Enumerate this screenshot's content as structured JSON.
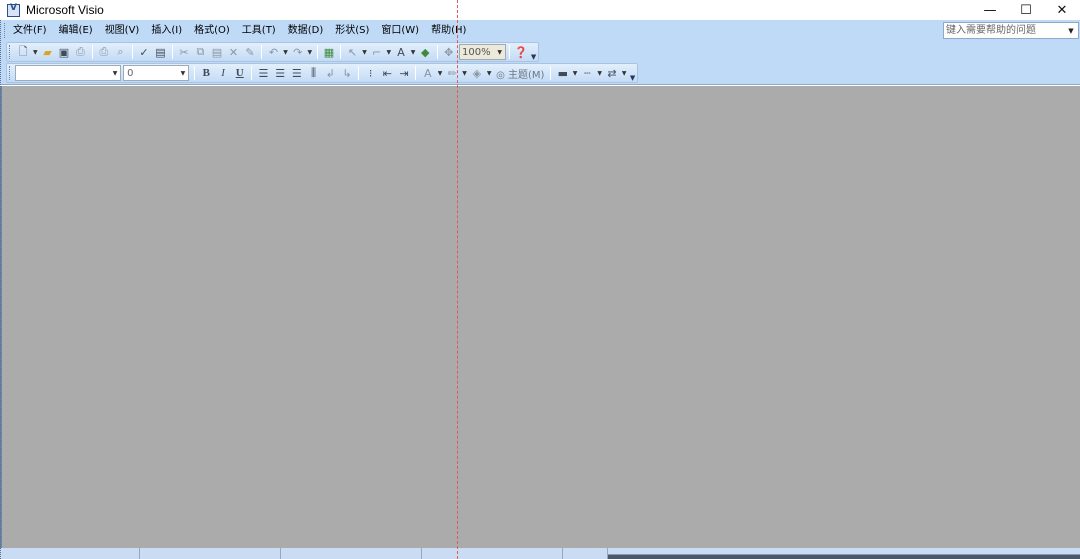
{
  "window": {
    "title": "Microsoft Visio",
    "minimize_glyph": "—",
    "maximize_glyph": "☐",
    "close_glyph": "✕"
  },
  "menubar": {
    "items": [
      "文件(F)",
      "编辑(E)",
      "视图(V)",
      "插入(I)",
      "格式(O)",
      "工具(T)",
      "数据(D)",
      "形状(S)",
      "窗口(W)",
      "帮助(H)"
    ],
    "help_placeholder": "键入需要帮助的问题"
  },
  "toolbar_standard": {
    "icons": [
      "new-icon",
      "open-icon",
      "save-icon",
      "permission-icon",
      "print-icon",
      "print-preview-icon",
      "spelling-icon",
      "research-icon",
      "cut-icon",
      "copy-icon",
      "paste-icon",
      "delete-icon",
      "format-painter-icon",
      "undo-icon",
      "redo-icon",
      "shapes-icon",
      "pointer-tool-icon",
      "connector-tool-icon",
      "text-tool-icon",
      "stamp-icon",
      "pan-zoom-icon",
      "help-icon"
    ],
    "zoom": "100%"
  },
  "toolbar_formatting": {
    "font_name": "",
    "font_size": "0",
    "bold": "B",
    "italic": "I",
    "underline": "U",
    "theme_label": "主题(M)"
  },
  "colors": {
    "command_bar": "#bfdaf7",
    "workspace": "#ababab",
    "guide": "#e05a5a"
  }
}
